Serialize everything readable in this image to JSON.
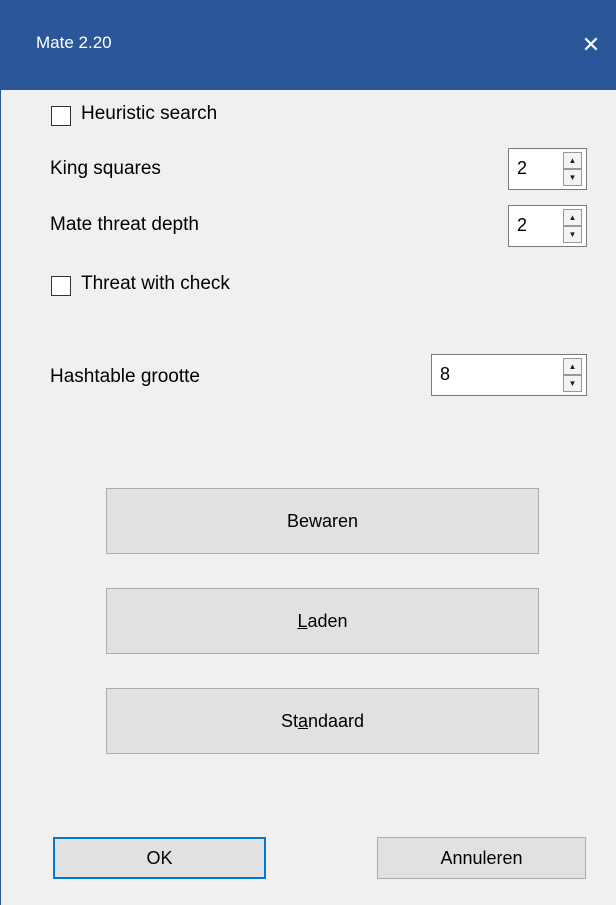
{
  "window": {
    "title": "Mate 2.20",
    "close_glyph": "✕"
  },
  "options": {
    "heuristic_search": {
      "label": "Heuristic search",
      "checked": false
    },
    "king_squares": {
      "label": "King squares",
      "value": "2"
    },
    "mate_threat_depth": {
      "label": "Mate threat depth",
      "value": "2"
    },
    "threat_with_check": {
      "label": "Threat with check",
      "checked": false
    },
    "hashtable_size": {
      "label": "Hashtable grootte",
      "value": "8"
    }
  },
  "buttons": {
    "save": "Bewaren",
    "load": {
      "before": "",
      "underlined": "L",
      "after": "aden"
    },
    "default": {
      "before": "St",
      "underlined": "a",
      "after": "ndaard"
    },
    "ok": "OK",
    "cancel": "Annuleren"
  },
  "colors": {
    "titlebar": "#2b579a",
    "background": "#f0f0f0",
    "default_button_border": "#0078d7"
  }
}
